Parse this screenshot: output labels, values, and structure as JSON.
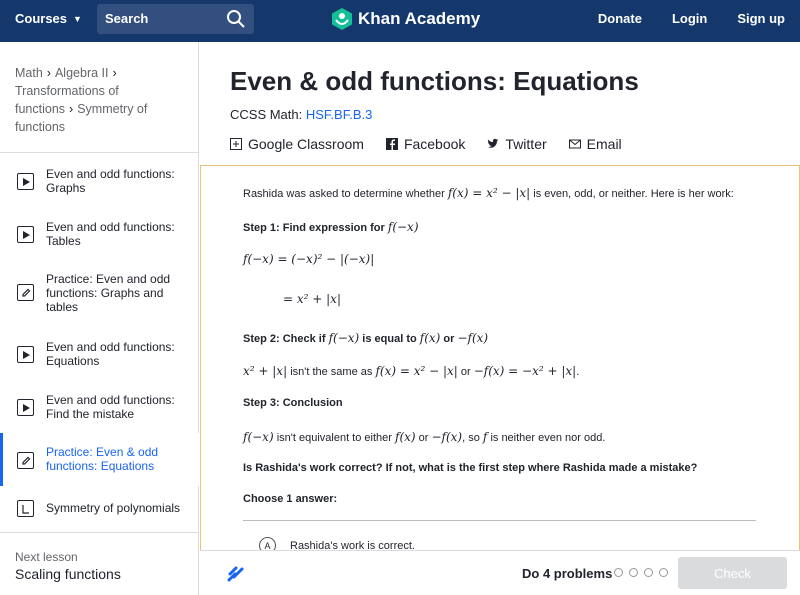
{
  "header": {
    "courses": "Courses",
    "search": "Search",
    "logo": "Khan Academy",
    "donate": "Donate",
    "login": "Login",
    "signup": "Sign up"
  },
  "breadcrumb": {
    "math": "Math",
    "algebra": "Algebra II",
    "unit": "Transformations of functions",
    "lesson": "Symmetry of functions"
  },
  "sidebar": {
    "items": [
      {
        "label": "Even and odd functions: Graphs",
        "icon": "play-icon"
      },
      {
        "label": "Even and odd functions: Tables",
        "icon": "play-icon"
      },
      {
        "label": "Practice: Even and odd functions: Graphs and tables",
        "icon": "pencil-icon"
      },
      {
        "label": "Even and odd functions: Equations",
        "icon": "play-icon"
      },
      {
        "label": "Even and odd functions: Find the mistake",
        "icon": "play-icon"
      },
      {
        "label": "Practice: Even & odd functions: Equations",
        "icon": "pencil-icon"
      },
      {
        "label": "Symmetry of polynomials",
        "icon": "article-icon"
      }
    ],
    "next_label": "Next lesson",
    "next_value": "Scaling functions"
  },
  "page": {
    "title": "Even & odd functions: Equations",
    "ccss_label": "CCSS Math:",
    "ccss_code": "HSF.BF.B.3"
  },
  "share": {
    "classroom": "Google Classroom",
    "facebook": "Facebook",
    "twitter": "Twitter",
    "email": "Email"
  },
  "exercise": {
    "intro_a": "Rashida was asked to determine whether",
    "intro_b": "is even, odd, or neither. Here is her work:",
    "step1": "Step 1: Find expression for",
    "step2_a": "Step 2: Check if",
    "step2_b": "is equal to",
    "step2_c": "or",
    "step2_line_a": "isn't the same as",
    "step2_line_b": "or",
    "step3": "Step 3: Conclusion",
    "concl_a": "isn't equivalent to either",
    "concl_b": "or",
    "concl_c": ", so",
    "concl_d": "is neither even nor odd.",
    "question": "Is Rashida's work correct? If not, what is the first step where Rashida made a mistake?",
    "choose": "Choose 1 answer:",
    "choice_a_letter": "A",
    "choice_a": "Rashida's work is correct."
  },
  "footer": {
    "do_problems": "Do 4 problems",
    "check": "Check"
  },
  "colors": {
    "header_bg": "#14386b",
    "accent": "#1865f2",
    "exercise_border": "#e8c47a"
  }
}
